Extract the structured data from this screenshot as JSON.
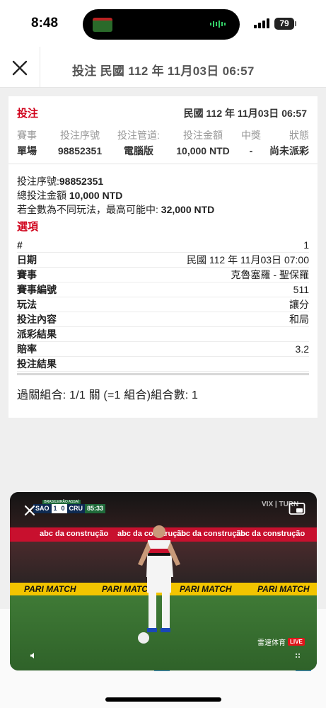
{
  "status_bar": {
    "time": "8:48",
    "battery": "79"
  },
  "header": {
    "title": "投注 民國 112 年 11月03日 06:57"
  },
  "bet": {
    "title": "投注",
    "date": "民國 112 年 11月03日 06:57",
    "summary_headers": [
      "賽事",
      "投注序號",
      "投注管道:",
      "投注金額",
      "中獎",
      "狀態"
    ],
    "summary_values": [
      "單場",
      "98852351",
      "電腦版",
      "10,000 NTD",
      "-",
      "尚未派彩"
    ],
    "serial_label": "投注序號:",
    "serial_value": "98852351",
    "total_label": "總投注金額 ",
    "total_value": "10,000 NTD",
    "max_label": "若全數為不同玩法，最高可能中: ",
    "max_value": "32,000 NTD",
    "options_title": "選項",
    "options": [
      {
        "key": "#",
        "value": "1"
      },
      {
        "key": "日期",
        "value": "民國 112 年 11月03日 07:00"
      },
      {
        "key": "賽事",
        "value": "克魯塞羅 - 聖保羅"
      },
      {
        "key": "賽事編號",
        "value": "511"
      },
      {
        "key": "玩法",
        "value": "讓分"
      },
      {
        "key": "投注內容",
        "value": "和局"
      },
      {
        "key": "派彩結果",
        "value": ""
      },
      {
        "key": "賠率",
        "value": "3.2"
      },
      {
        "key": "投注結果",
        "value": ""
      }
    ],
    "combo": "過關組合: 1/1 關 (=1 組合)組合數: 1"
  },
  "video": {
    "league": "BRASILEIRÃO ASSAÍ",
    "home": "SAO",
    "home_score": "1",
    "away_score": "0",
    "away": "CRU",
    "clock": "85:33",
    "broadcaster": "VIX | TURN",
    "ad_text": "abc da construção",
    "sponsor": "PARI MATCH",
    "watermark": "雷速体育",
    "live": "LIVE"
  },
  "colors": {
    "accent": "#d0021b",
    "link": "#3a8bd6"
  }
}
